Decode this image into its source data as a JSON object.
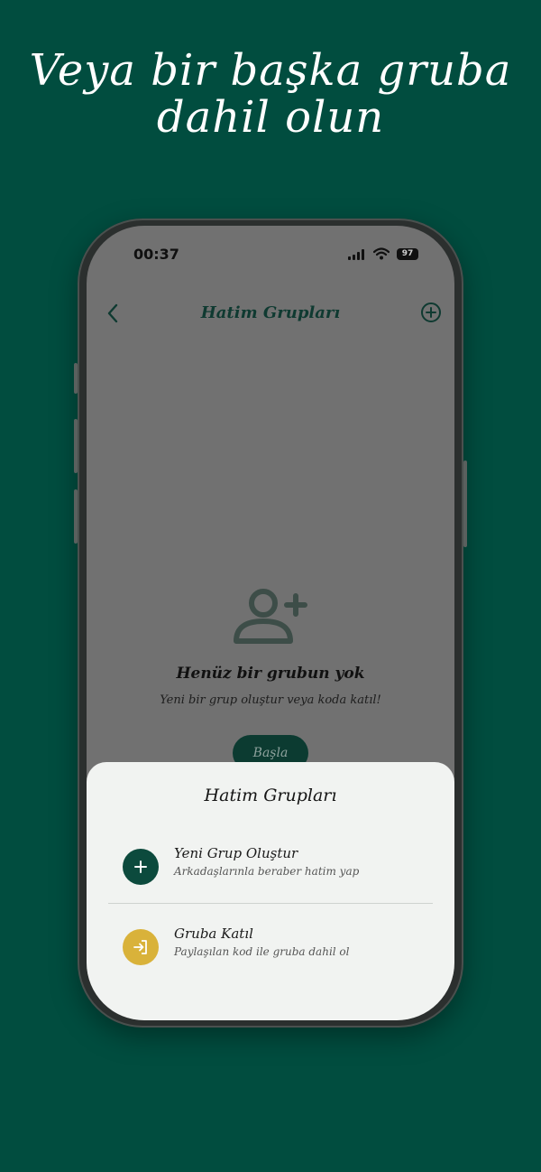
{
  "headline": {
    "line1": "Veya bir başka gruba",
    "line2": "dahil olun"
  },
  "status_bar": {
    "time": "00:37",
    "battery": "97"
  },
  "nav": {
    "title": "Hatim Grupları",
    "back_icon": "chevron-left-icon",
    "add_icon": "plus-circle-icon"
  },
  "empty_state": {
    "icon": "person-add-icon",
    "title": "Henüz bir grubun yok",
    "subtitle": "Yeni bir grup oluştur veya koda katıl!",
    "button_label": "Başla"
  },
  "sheet": {
    "title": "Hatim Grupları",
    "options": [
      {
        "label": "Yeni Grup Oluştur",
        "description": "Arkadaşlarınla beraber hatim yap",
        "icon": "plus-icon",
        "color": "#0c4a3d"
      },
      {
        "label": "Gruba Katıl",
        "description": "Paylaşılan kod ile gruba dahil ol",
        "icon": "login-icon",
        "color": "#d9b23a"
      }
    ]
  },
  "colors": {
    "background": "#014d3f",
    "accent_green": "#0c4a3d",
    "accent_gold": "#d9b23a"
  }
}
